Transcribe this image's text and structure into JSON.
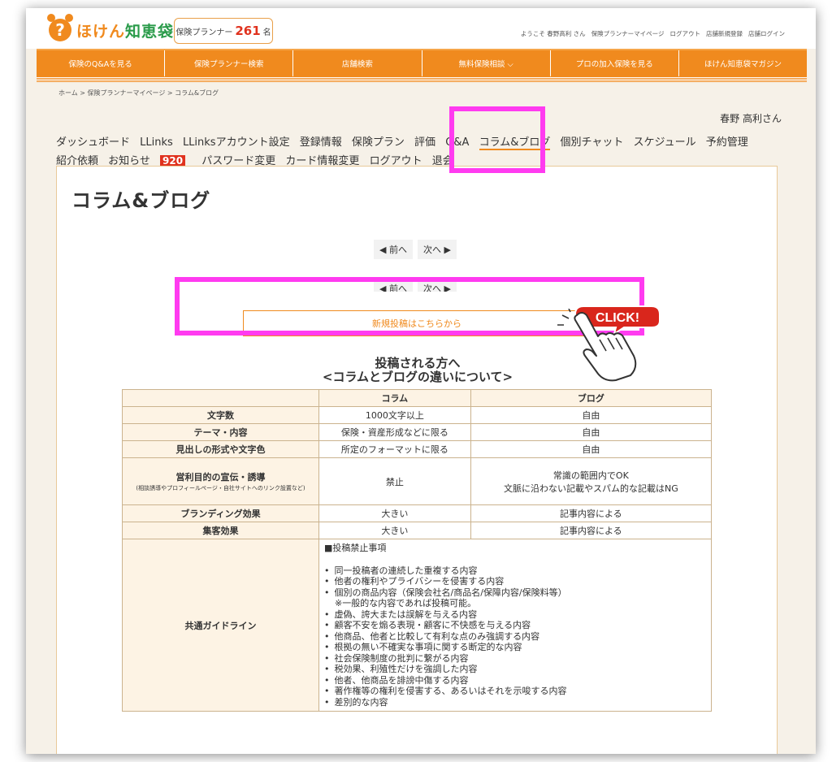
{
  "header": {
    "logo_text_a": "ほけん",
    "logo_text_b": "知恵袋",
    "planner_label": "保険プランナー",
    "planner_count": "261",
    "planner_unit": "名",
    "top_links": [
      "ようこそ 春野高利 さん",
      "保険プランナーマイページ",
      "ログアウト",
      "店舗新規登録",
      "店舗ログイン"
    ]
  },
  "nav": [
    "保険のQ&Aを見る",
    "保険プランナー検索",
    "店舗検索",
    "無料保険相談 ⌵",
    "プロの加入保険を見る",
    "ほけん知恵袋マガジン"
  ],
  "breadcrumb": "ホーム > 保険プランナーマイページ > コラム&ブログ",
  "user_name": "春野 高利さん",
  "tabs": [
    "ダッシュボード",
    "LLinks",
    "LLinksアカウント設定",
    "登録情報",
    "保険プラン",
    "評価",
    "Q&A",
    "コラム&ブログ",
    "個別チャット",
    "スケジュール",
    "予約管理",
    "紹介依頼",
    "お知らせ",
    "パスワード変更",
    "カード情報変更",
    "ログアウト",
    "退会"
  ],
  "notice_count": "920",
  "page_title": "コラム&ブログ",
  "pager": {
    "prev": "◀ 前へ",
    "next": "次へ ▶"
  },
  "new_post_label": "新規投稿はこちらから",
  "click_label": "CLICK!",
  "guide_heading_1": "投稿される方へ",
  "guide_heading_2": "<コラムとブログの違いについて>",
  "table": {
    "headers": [
      "",
      "コラム",
      "ブログ"
    ],
    "rows": [
      [
        "文字数",
        "1000文字以上",
        "自由"
      ],
      [
        "テーマ・内容",
        "保険・資産形成などに限る",
        "自由"
      ],
      [
        "見出しの形式や文字色",
        "所定のフォーマットに限る",
        "自由"
      ],
      [
        "営利目的の宣伝・誘導",
        "禁止",
        "常識の範囲内でOK"
      ],
      [
        "ブランディング効果",
        "大きい",
        "記事内容による"
      ],
      [
        "集客効果",
        "大きい",
        "記事内容による"
      ]
    ],
    "commercial_note": "(相談誘導やプロフィールページ・自社サイトへのリンク設置など)",
    "commercial_blog_2": "文脈に沿わない記載やスパム的な記載はNG",
    "guideline_label": "共通ガイドライン",
    "prohibited_title": "■投稿禁止事項",
    "prohibited": [
      "同一投稿者の連続した重複する内容",
      "他者の権利やプライバシーを侵害する内容",
      "個別の商品内容（保険会社名/商品名/保障内容/保険料等）",
      "虚偽、誇大または誤解を与える内容",
      "顧客不安を煽る表現・顧客に不快感を与える内容",
      "他商品、他者と比較して有利な点のみ強調する内容",
      "根拠の無い不確実な事項に関する断定的な内容",
      "社会保険制度の批判に繋がる内容",
      "税効果、利殖性だけを強調した内容",
      "他者、他商品を誹謗中傷する内容",
      "著作権等の権利を侵害する、あるいはそれを示唆する内容",
      "差別的な内容"
    ],
    "prohibited_note": "※一般的な内容であれば投稿可能。"
  },
  "colors": {
    "accent": "#f08a1e",
    "highlight": "#ff3bf0",
    "badge": "#e0321e"
  }
}
